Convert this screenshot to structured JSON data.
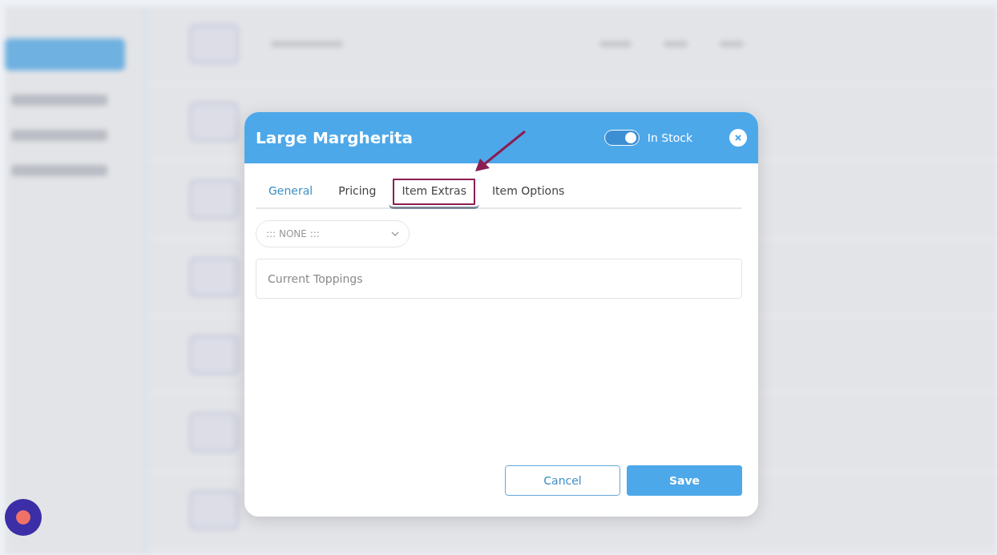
{
  "dialog": {
    "title": "Large Margherita",
    "stock_toggle": {
      "label": "In Stock",
      "on": true
    },
    "tabs": [
      {
        "label": "General",
        "selected": false,
        "accent": true,
        "callout": false
      },
      {
        "label": "Pricing",
        "selected": false,
        "accent": false,
        "callout": false
      },
      {
        "label": "Item Extras",
        "selected": true,
        "accent": false,
        "callout": true
      },
      {
        "label": "Item Options",
        "selected": false,
        "accent": false,
        "callout": false
      }
    ],
    "extras_dropdown": {
      "value": "::: NONE :::"
    },
    "toppings_field": {
      "placeholder": "Current Toppings"
    },
    "buttons": [
      {
        "label": "Cancel",
        "kind": "secondary"
      },
      {
        "label": "Save",
        "kind": "primary"
      }
    ]
  }
}
